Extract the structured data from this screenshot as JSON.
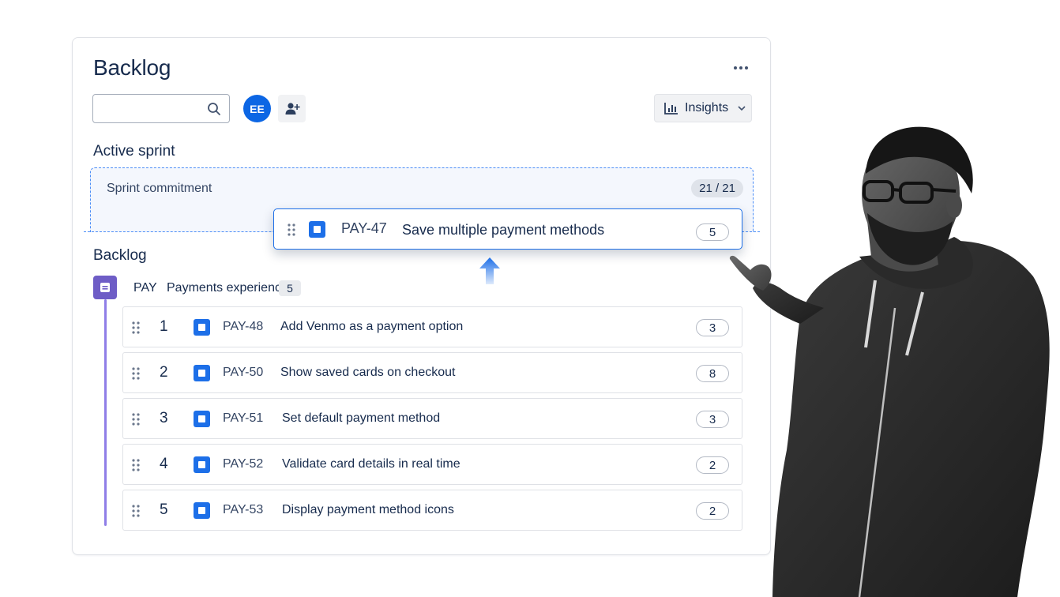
{
  "header": {
    "title": "Backlog"
  },
  "toolbar": {
    "search_value": "",
    "avatar_initials": "EE",
    "insights_label": "Insights"
  },
  "sprint": {
    "title": "Active sprint",
    "commitment_label": "Sprint commitment",
    "commitment_count": "21 / 21"
  },
  "dragging": {
    "key": "PAY-47",
    "summary": "Save multiple payment methods",
    "points": "5"
  },
  "backlog": {
    "title": "Backlog",
    "epic": {
      "key": "PAY",
      "name": "Payments experience",
      "count": "5"
    },
    "items": [
      {
        "rank": "1",
        "key": "PAY-48",
        "summary": "Add Venmo as a payment option",
        "points": "3"
      },
      {
        "rank": "2",
        "key": "PAY-50",
        "summary": "Show saved cards on checkout",
        "points": "8"
      },
      {
        "rank": "3",
        "key": "PAY-51",
        "summary": "Set default payment method",
        "points": "3"
      },
      {
        "rank": "4",
        "key": "PAY-52",
        "summary": "Validate card details in real time",
        "points": "2"
      },
      {
        "rank": "5",
        "key": "PAY-53",
        "summary": "Display payment method icons",
        "points": "2"
      }
    ]
  },
  "colors": {
    "accent": "#0c66e4",
    "epic": "#6e5dc6",
    "story": "#1d6fe8",
    "drop_zone": "#4c8ef7"
  },
  "icons": [
    "search-icon",
    "add-person-icon",
    "more-icon",
    "bar-chart-icon",
    "chevron-down-icon",
    "drag-handle-icon",
    "story-icon",
    "epic-icon",
    "arrow-up-icon"
  ]
}
